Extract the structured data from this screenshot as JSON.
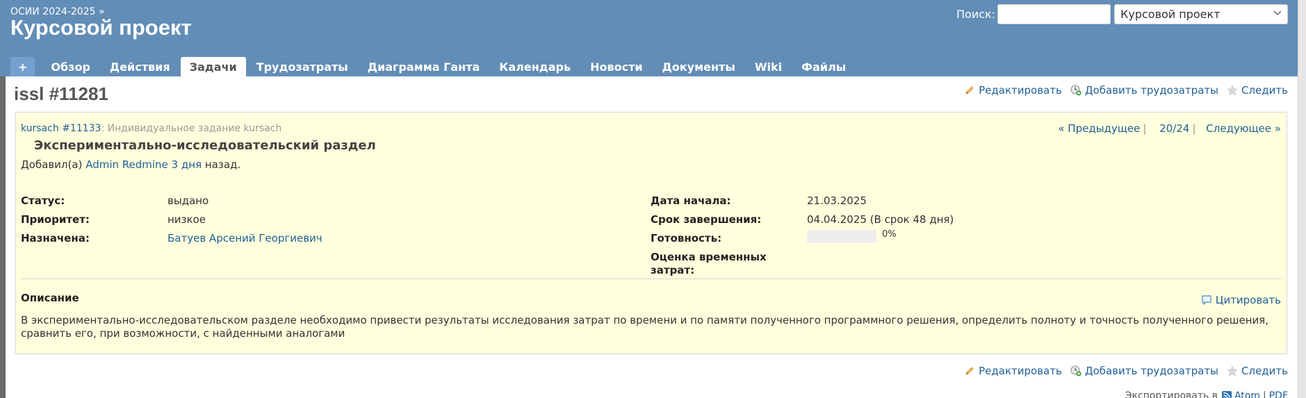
{
  "header": {
    "breadcrumb": "ОСИИ 2024-2025 »",
    "project_title": "Курсовой проект",
    "search_label": "Поиск:",
    "search_value": "",
    "project_select_value": "Курсовой проект"
  },
  "menu": {
    "new": "+",
    "tabs": [
      "Обзор",
      "Действия",
      "Задачи",
      "Трудозатраты",
      "Диаграмма Ганта",
      "Календарь",
      "Новости",
      "Документы",
      "Wiki",
      "Файлы"
    ],
    "selected": "Задачи"
  },
  "issue": {
    "heading": "issl #11281",
    "parent_link": "kursach #11133",
    "parent_title": ": Индивидуальное задание kursach",
    "prev": "« Предыдущее",
    "position": "20/24",
    "next": "Следующее »",
    "subject": "Экспериментально-исследовательский раздел",
    "added_by_prefix": "Добавил(а)",
    "author": "Admin Redmine",
    "age": "3 дня",
    "ago": "назад."
  },
  "actions": {
    "edit": "Редактировать",
    "log_time": "Добавить трудозатраты",
    "watch": "Следить"
  },
  "attributes": {
    "status_label": "Статус:",
    "status_value": "выдано",
    "priority_label": "Приоритет:",
    "priority_value": "низкое",
    "assigned_label": "Назначена:",
    "assigned_value": "Батуев Арсений Георгиевич",
    "start_label": "Дата начала:",
    "start_value": "21.03.2025",
    "due_label": "Срок завершения:",
    "due_value": "04.04.2025 (В срок 48 дня)",
    "done_label": "Готовность:",
    "done_value": "0%",
    "done_ratio": 0,
    "estimate_label_1": "Оценка временных",
    "estimate_label_2": "затрат:"
  },
  "description": {
    "title": "Описание",
    "quote": "Цитировать",
    "line1": "В экспериментально-исследовательском разделе необходимо привести результаты исследования затрат по времени и по памяти полученного программного решения, определить полноту и точность полученного решения,",
    "line2": "сравнить его, при возможности, с найденными аналогами"
  },
  "footer": {
    "export_label": "Экспортировать в",
    "atom": "Atom",
    "pdf": "PDF"
  },
  "colors": {
    "header_bg": "#628db6",
    "issue_bg": "#ffffdd",
    "link": "#1f5f96"
  },
  "icons": [
    "pencil-icon",
    "clock-add-icon",
    "star-icon",
    "comment-icon",
    "feed-icon",
    "chevron-down-icon"
  ]
}
